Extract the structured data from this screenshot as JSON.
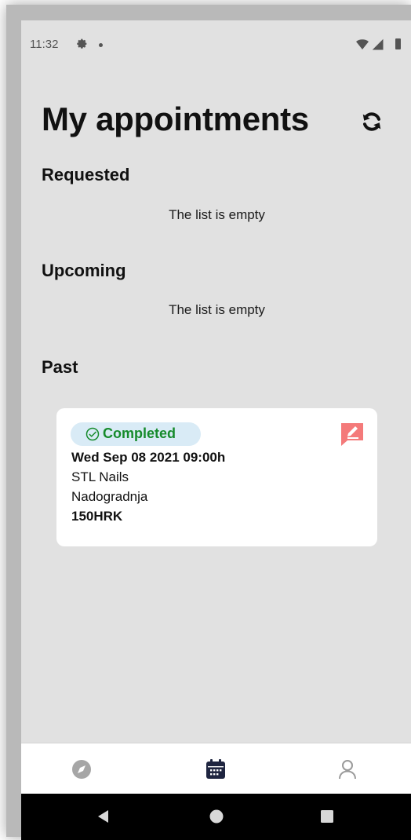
{
  "status_bar": {
    "time": "11:32"
  },
  "header": {
    "title": "My appointments"
  },
  "sections": {
    "requested": {
      "heading": "Requested",
      "empty_text": "The list is empty"
    },
    "upcoming": {
      "heading": "Upcoming",
      "empty_text": "The list is empty"
    },
    "past": {
      "heading": "Past"
    }
  },
  "appointment": {
    "status": "Completed",
    "datetime": "Wed Sep 08 2021 09:00h",
    "salon": "STL Nails",
    "service": "Nadogradnja",
    "price": "150HRK"
  },
  "colors": {
    "background": "#e1e1e1",
    "status_green": "#168b2c",
    "badge_bg": "#d9ebf6",
    "review_red": "#f47a7a",
    "nav_active": "#1f2540"
  },
  "icons": {
    "status": [
      "gear-icon",
      "dot-icon",
      "wifi-icon",
      "signal-icon",
      "battery-icon"
    ],
    "header": "refresh-icon",
    "card": [
      "check-circle-icon",
      "review-edit-icon"
    ],
    "bottom_nav": [
      "compass-icon",
      "calendar-icon",
      "profile-icon"
    ],
    "system_nav": [
      "back-icon",
      "home-icon",
      "recents-icon"
    ]
  }
}
